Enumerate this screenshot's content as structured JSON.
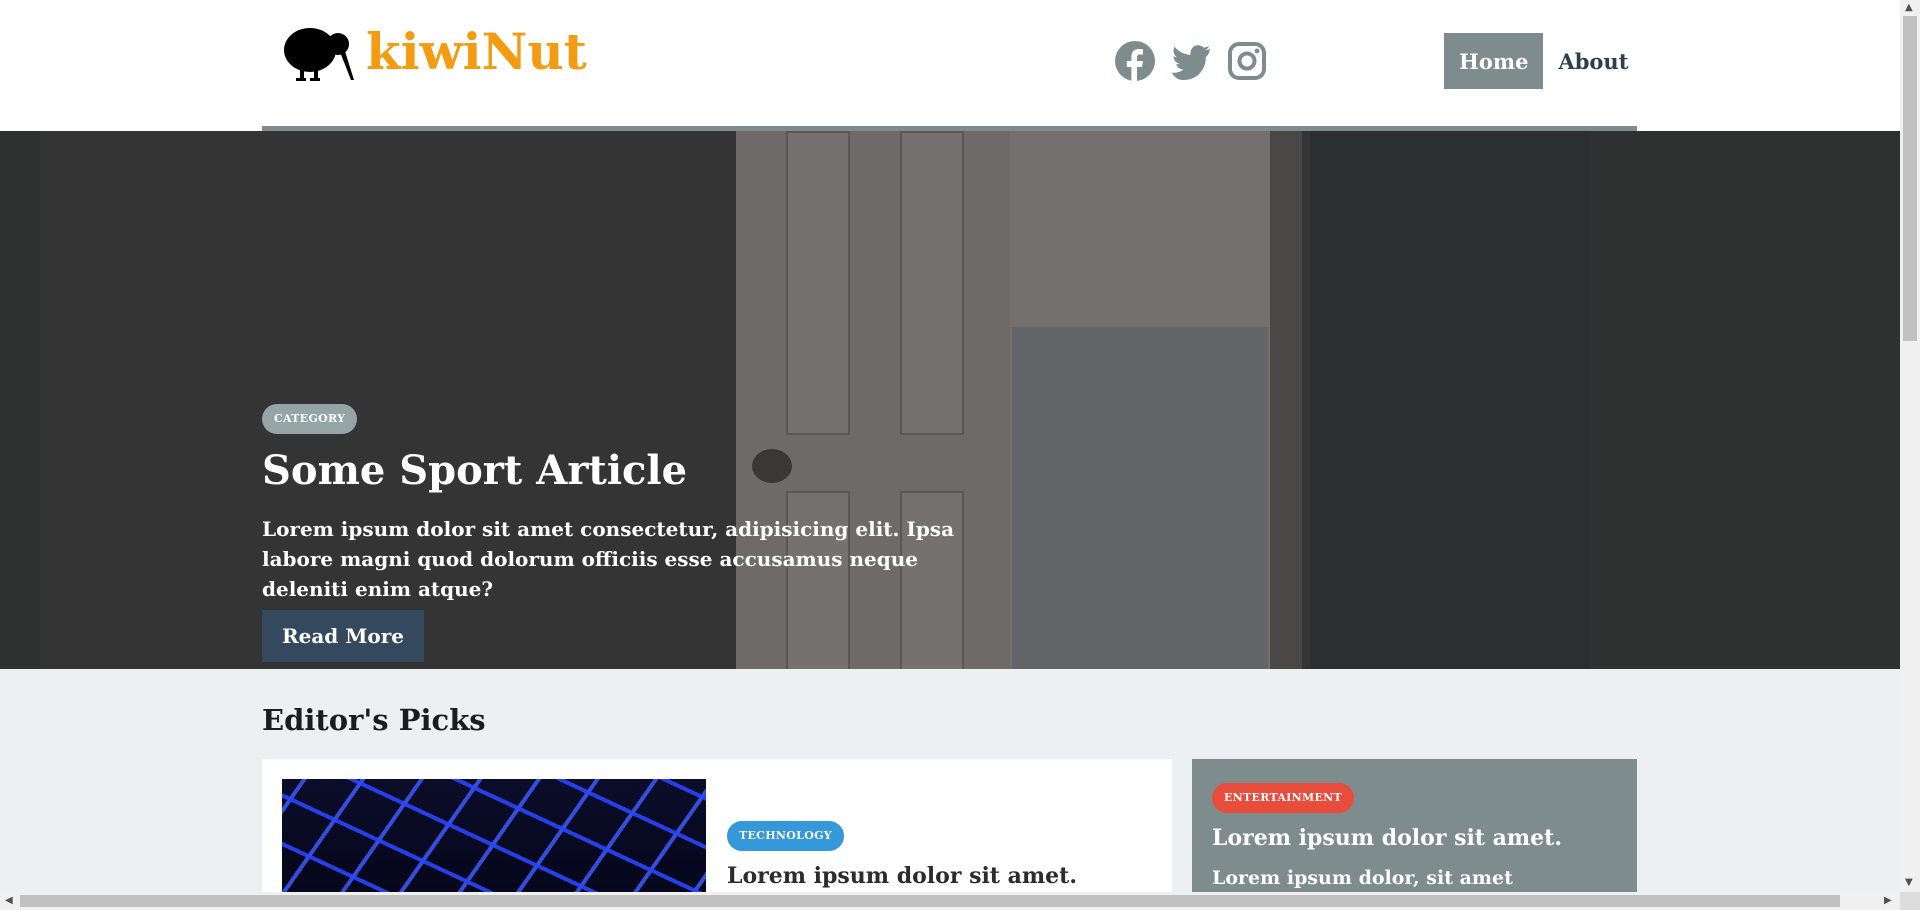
{
  "brand": {
    "name": "kiwiNut",
    "logo_icon": "kiwi-bird-icon",
    "color": "#f39c12"
  },
  "social": [
    {
      "icon": "facebook-icon"
    },
    {
      "icon": "twitter-icon"
    },
    {
      "icon": "instagram-icon"
    }
  ],
  "nav": {
    "home": "Home",
    "about": "About",
    "active": "Home",
    "accent": "#7f8c8d"
  },
  "hero": {
    "category": "CATEGORY",
    "title": "Some Sport Article",
    "text": "Lorem ipsum dolor sit amet consectetur, adipisicing elit. Ipsa labore magni quod dolorum officiis esse accusamus neque deleniti enim atque?",
    "button": "Read More",
    "button_color": "#34495e"
  },
  "picks": {
    "heading": "Editor's Picks",
    "main": {
      "category": "TECHNOLOGY",
      "category_color": "#3498db",
      "title": "Lorem ipsum dolor sit amet."
    },
    "side": {
      "category": "ENTERTAINMENT",
      "category_color": "#e74c3c",
      "title": "Lorem ipsum dolor sit amet.",
      "text": "Lorem ipsum dolor, sit amet consectetur"
    }
  }
}
